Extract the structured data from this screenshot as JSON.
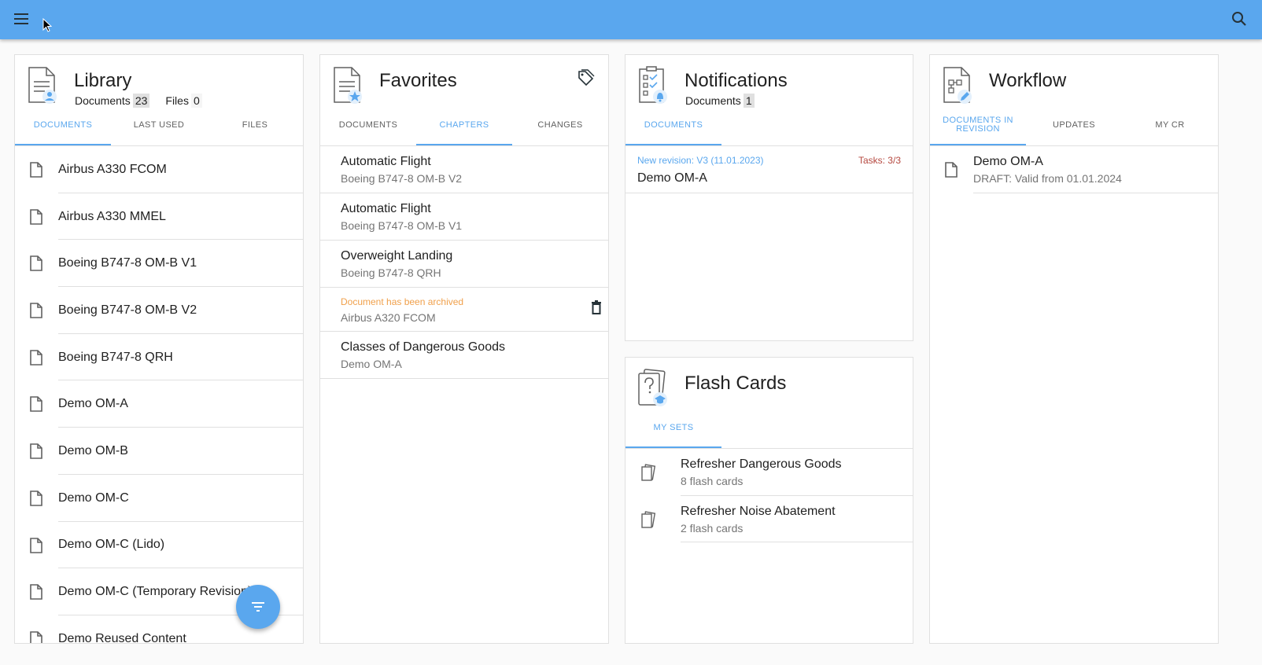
{
  "topbar": {
    "menu_icon": "hamburger-menu-icon",
    "search_icon": "search-icon",
    "color": "#5aa7ee"
  },
  "library": {
    "title": "Library",
    "documents_label": "Documents",
    "documents_count": "23",
    "files_label": "Files",
    "files_count": "0",
    "tabs": [
      "DOCUMENTS",
      "LAST USED",
      "FILES"
    ],
    "active_tab": 0,
    "items": [
      "Airbus A330 FCOM",
      "Airbus A330 MMEL",
      "Boeing B747-8 OM-B V1",
      "Boeing B747-8 OM-B V2",
      "Boeing B747-8 QRH",
      "Demo OM-A",
      "Demo OM-B",
      "Demo OM-C",
      "Demo OM-C (Lido)",
      "Demo OM-C (Temporary Revision)",
      "Demo Reused Content"
    ]
  },
  "favorites": {
    "title": "Favorites",
    "tabs": [
      "DOCUMENTS",
      "CHAPTERS",
      "CHANGES"
    ],
    "active_tab": 1,
    "items": [
      {
        "title": "Automatic Flight",
        "subtitle": "Boeing B747-8 OM-B V2"
      },
      {
        "title": "Automatic Flight",
        "subtitle": "Boeing B747-8 OM-B V1"
      },
      {
        "title": "Overweight Landing",
        "subtitle": "Boeing B747-8 QRH"
      }
    ],
    "archived": {
      "notice": "Document has been archived",
      "subtitle": "Airbus A320 FCOM"
    },
    "last_item": {
      "title": "Classes of Dangerous Goods",
      "subtitle": "Demo OM-A"
    }
  },
  "notifications": {
    "title": "Notifications",
    "documents_label": "Documents",
    "documents_count": "1",
    "tabs": [
      "DOCUMENTS"
    ],
    "item": {
      "revision": "New revision: V3 (11.01.2023)",
      "tasks": "Tasks: 3/3",
      "title": "Demo OM-A"
    }
  },
  "flash_cards": {
    "title": "Flash Cards",
    "tabs": [
      "MY SETS"
    ],
    "items": [
      {
        "title": "Refresher Dangerous Goods",
        "subtitle": "8 flash cards"
      },
      {
        "title": "Refresher Noise Abatement",
        "subtitle": "2 flash cards"
      }
    ]
  },
  "workflow": {
    "title": "Workflow",
    "tab_documents_line1": "DOCUMENTS IN",
    "tab_documents_line2": "REVISION",
    "tabs": [
      "UPDATES",
      "MY CR"
    ],
    "item": {
      "title": "Demo OM-A",
      "subtitle": "DRAFT: Valid from 01.01.2024"
    }
  },
  "colors": {
    "accent": "#5aa7ee",
    "warning": "#f0a04b",
    "tasks": "#b5483f"
  }
}
